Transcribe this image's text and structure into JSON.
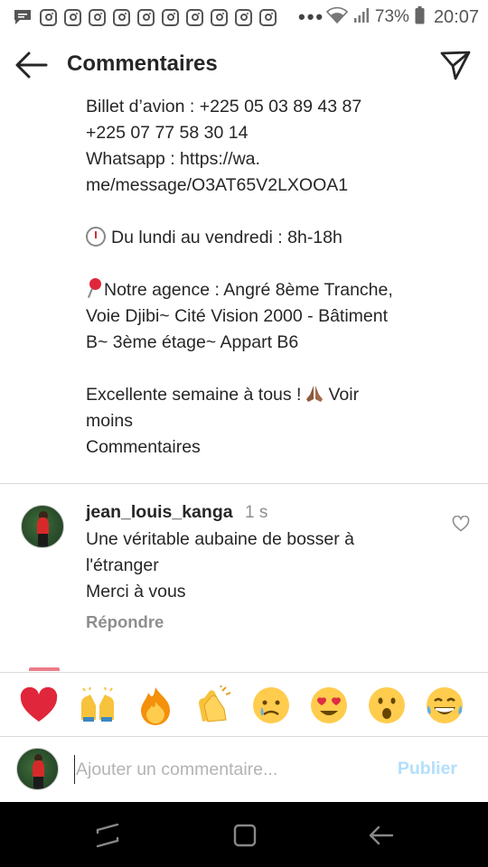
{
  "status_bar": {
    "dots": "•••",
    "battery_percent": "73%",
    "time": "20:07",
    "icon_names": [
      "message-icon",
      "instagram-icon",
      "instagram-icon",
      "instagram-icon",
      "instagram-icon",
      "instagram-icon",
      "instagram-icon",
      "instagram-icon",
      "instagram-icon",
      "instagram-icon",
      "instagram-icon"
    ]
  },
  "header": {
    "title": "Commentaires",
    "back_icon": "arrow-left-icon",
    "send_icon": "paper-plane-icon"
  },
  "caption": {
    "lines": [
      "Billet d’avion : +225 05 03 89 43 87",
      "+225 07 77 58 30 14",
      "Whatsapp : https://wa.",
      "me/message/O3AT65V2LXOOA1",
      "Du lundi au vendredi : 8h-18h",
      "Notre agence : Angré 8ème Tranche,",
      "Voie Djibi~ Cité Vision 2000 - Bâtiment",
      "B~ 3ème étage~ Appart B6",
      "Excellente semaine à tous !",
      "Voir",
      "moins",
      "Commentaires"
    ]
  },
  "comment": {
    "username": "jean_louis_kanga",
    "time": "1 s",
    "lines": [
      "Une véritable aubaine de bosser à",
      "l'étranger",
      "Merci à vous"
    ],
    "reply_label": "Répondre",
    "like_icon": "heart-outline-icon"
  },
  "emoji_bar": {
    "items": [
      "red-heart-emoji",
      "raising-hands-emoji",
      "fire-emoji",
      "clapping-hands-emoji",
      "crying-face-emoji",
      "heart-eyes-emoji",
      "surprised-face-emoji",
      "tears-of-joy-emoji"
    ]
  },
  "input": {
    "placeholder": "Ajouter un commentaire...",
    "value": "",
    "publish_label": "Publier",
    "publish_color": "#b2dffc"
  },
  "nav_bar": {
    "buttons": [
      "recent-apps-icon",
      "home-icon",
      "back-icon"
    ]
  },
  "colors": {
    "text": "#262626",
    "secondary_text": "#8e8e8e",
    "divider": "#dbdbdb",
    "nav_background": "#000000"
  }
}
